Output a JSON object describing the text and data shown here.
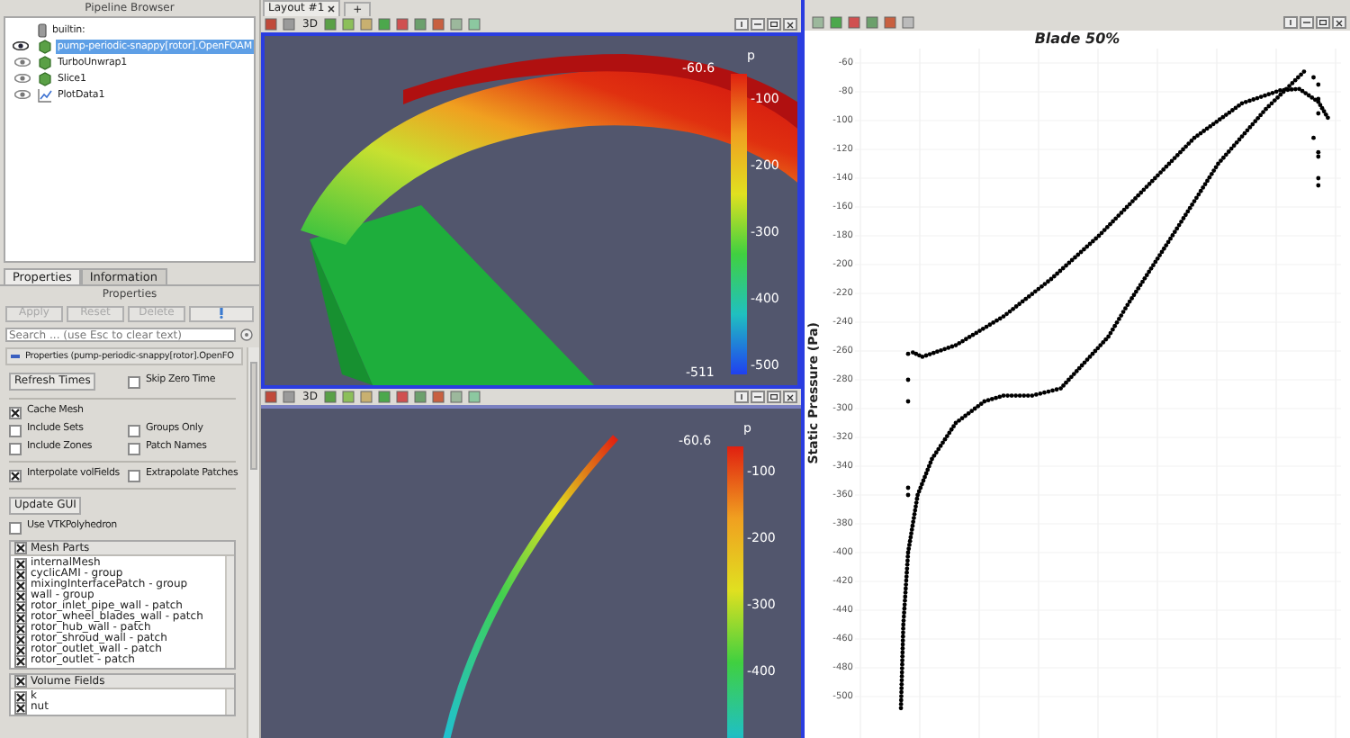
{
  "pipeline_browser": {
    "title": "Pipeline Browser",
    "items": [
      {
        "label": "builtin:",
        "kind": "server",
        "selected": false
      },
      {
        "label": "pump-periodic-snappy[rotor].OpenFOAM",
        "kind": "reader",
        "selected": true
      },
      {
        "label": "TurboUnwrap1",
        "kind": "filter",
        "selected": false
      },
      {
        "label": "Slice1",
        "kind": "filter",
        "selected": false
      },
      {
        "label": "PlotData1",
        "kind": "plot",
        "selected": false
      }
    ]
  },
  "panel_tabs": [
    {
      "label": "Properties",
      "selected": true
    },
    {
      "label": "Information",
      "selected": false
    }
  ],
  "properties": {
    "title": "Properties",
    "buttons": [
      {
        "label": "Apply",
        "disabled": true
      },
      {
        "label": "Reset",
        "disabled": true
      },
      {
        "label": "Delete",
        "disabled": true
      }
    ],
    "search": {
      "placeholder": "Search ... (use Esc to clear text)"
    },
    "section": "Properties (pump-periodic-snappy[rotor].OpenFO",
    "rows": [
      {
        "kind": "options",
        "items": [
          {
            "kind": "button",
            "label": "Refresh Times"
          },
          {
            "kind": "checkbox",
            "label": "Skip Zero Time",
            "checked": false
          }
        ]
      },
      {
        "kind": "separator"
      },
      {
        "kind": "options",
        "items": [
          {
            "kind": "checkbox",
            "label": "Cache Mesh",
            "checked": true
          }
        ]
      },
      {
        "kind": "options",
        "items": [
          {
            "kind": "checkbox",
            "label": "Include Sets",
            "checked": false
          },
          {
            "kind": "checkbox",
            "label": "Groups Only",
            "checked": false
          }
        ]
      },
      {
        "kind": "options",
        "items": [
          {
            "kind": "checkbox",
            "label": "Include Zones",
            "checked": false
          },
          {
            "kind": "checkbox",
            "label": "Patch Names",
            "checked": false
          }
        ]
      },
      {
        "kind": "separator"
      },
      {
        "kind": "options",
        "items": [
          {
            "kind": "checkbox",
            "label": "Interpolate volFields",
            "checked": true
          },
          {
            "kind": "checkbox",
            "label": "Extrapolate Patches",
            "checked": false
          }
        ]
      },
      {
        "kind": "separator"
      },
      {
        "kind": "options",
        "items": [
          {
            "kind": "button",
            "label": "Update GUI"
          }
        ]
      },
      {
        "kind": "options",
        "items": [
          {
            "kind": "checkbox",
            "label": "Use VTKPolyhedron",
            "checked": false
          }
        ]
      }
    ],
    "lists": [
      {
        "title": "Mesh Parts",
        "checked": true,
        "items": [
          {
            "label": "internalMesh",
            "checked": true
          },
          {
            "label": "cyclicAMI - group",
            "checked": true
          },
          {
            "label": "mixingInterfacePatch - group",
            "checked": true
          },
          {
            "label": "wall - group",
            "checked": true
          },
          {
            "label": "rotor_inlet_pipe_wall - patch",
            "checked": true
          },
          {
            "label": "rotor_wheel_blades_wall - patch",
            "checked": true
          },
          {
            "label": "rotor_hub_wall - patch",
            "checked": true
          },
          {
            "label": "rotor_shroud_wall - patch",
            "checked": true
          },
          {
            "label": "rotor_outlet_wall - patch",
            "checked": true
          },
          {
            "label": "rotor_outlet - patch",
            "checked": true
          }
        ]
      },
      {
        "title": "Volume Fields",
        "checked": true,
        "items": [
          {
            "label": "k",
            "checked": true
          },
          {
            "label": "nut",
            "checked": true
          }
        ]
      }
    ]
  },
  "layout_tabs": [
    {
      "label": "Layout #1",
      "selected": true
    }
  ],
  "new_tab_button": "+",
  "views": [
    {
      "kind": "blade_3d",
      "active": true,
      "toolbar_label": "3D",
      "colorbar": {
        "title": "p",
        "max": "-60.6",
        "min": "-511",
        "ticks": [
          "-100",
          "-200",
          "-300",
          "-400",
          "-500"
        ]
      }
    },
    {
      "kind": "slice",
      "active": false,
      "toolbar_label": "3D",
      "colorbar": {
        "title": "p",
        "max": "-60.6",
        "ticks": [
          "-100",
          "-200",
          "-300",
          "-400"
        ]
      }
    }
  ],
  "plot": {
    "title": "Blade 50%",
    "ylabel": "Static Pressure (Pa)",
    "yticks": [
      "-60",
      "-80",
      "-100",
      "-120",
      "-140",
      "-160",
      "-180",
      "-200",
      "-220",
      "-240",
      "-260",
      "-280",
      "-300",
      "-320",
      "-340",
      "-360",
      "-380",
      "-400",
      "-420",
      "-440",
      "-460",
      "-480",
      "-500"
    ]
  }
}
